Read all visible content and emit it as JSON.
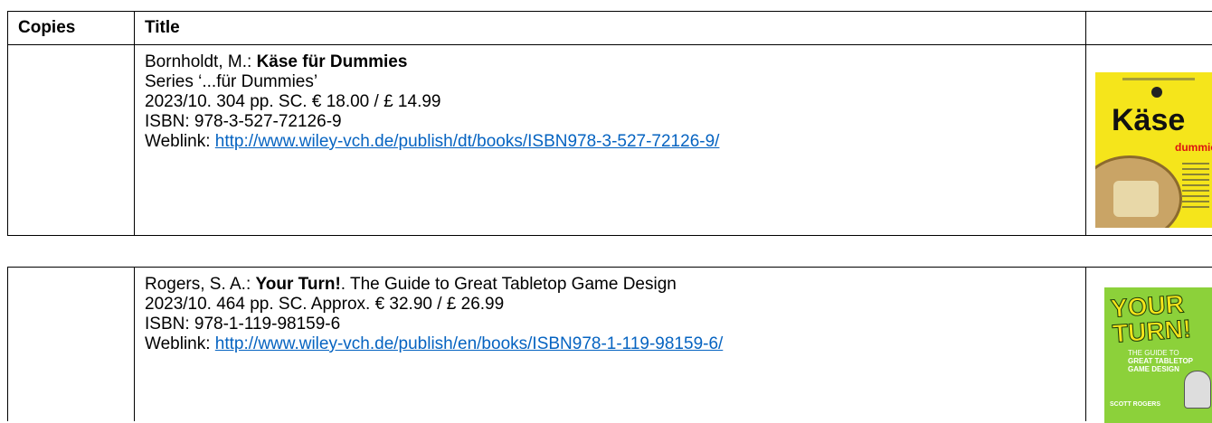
{
  "header": {
    "copies": "Copies",
    "title": "Title"
  },
  "books": [
    {
      "author": "Bornholdt, M.: ",
      "title_bold": "Käse für Dummies",
      "title_rest": "",
      "series": "Series ‘...für Dummies’",
      "details": "2023/10. 304 pp. SC. € 18.00 / £ 14.99",
      "isbn": "ISBN: 978-3-527-72126-9",
      "weblink_label": "Weblink: ",
      "weblink_url": "http://www.wiley-vch.de/publish/dt/books/ISBN978-3-527-72126-9/",
      "cover": {
        "title": "Käse",
        "brand": "dummies",
        "icon": "book-cover-image"
      }
    },
    {
      "author": "Rogers, S. A.: ",
      "title_bold": "Your Turn!",
      "title_rest": ". The Guide to Great Tabletop Game Design",
      "details": "2023/10. 464 pp. SC. Approx. € 32.90 / £ 26.99",
      "isbn": "ISBN: 978-1-119-98159-6",
      "weblink_label": "Weblink: ",
      "weblink_url": "http://www.wiley-vch.de/publish/en/books/ISBN978-1-119-98159-6/",
      "cover": {
        "title": "YOUR TURN!",
        "subtitle": "THE GUIDE TO",
        "subtitle_bold": "GREAT TABLETOP GAME DESIGN",
        "author": "SCOTT ROGERS",
        "icon": "book-cover-image"
      }
    }
  ],
  "colors": {
    "link": "#0563c1",
    "cover1_bg": "#f5e51b",
    "cover2_bg": "#8cd13a"
  }
}
